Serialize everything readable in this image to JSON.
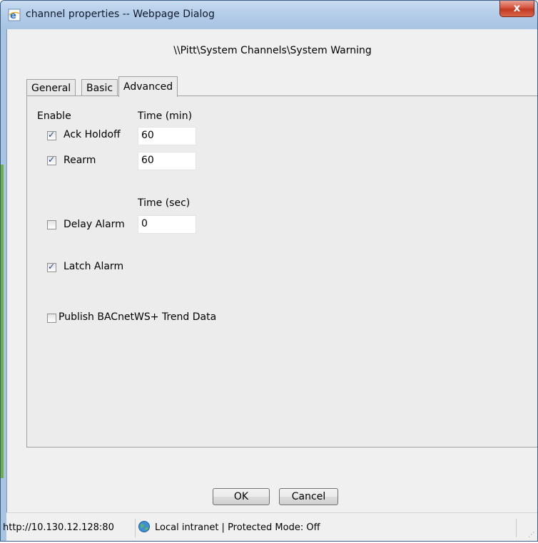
{
  "window": {
    "title": "channel properties -- Webpage Dialog",
    "close_label": "x"
  },
  "header": {
    "channel_path": "\\\\Pitt\\System Channels\\System Warning"
  },
  "tabs": [
    {
      "label": "General",
      "active": false
    },
    {
      "label": "Basic",
      "active": false
    },
    {
      "label": "Advanced",
      "active": true
    }
  ],
  "advanced": {
    "enable_header": "Enable",
    "time_min_header": "Time (min)",
    "time_sec_header": "Time (sec)",
    "ack_holdoff": {
      "label": "Ack Holdoff",
      "checked": true,
      "value": "60"
    },
    "rearm": {
      "label": "Rearm",
      "checked": true,
      "value": "60"
    },
    "delay_alarm": {
      "label": "Delay Alarm",
      "checked": false,
      "value": "0"
    },
    "latch_alarm": {
      "label": "Latch Alarm",
      "checked": true
    },
    "publish_trend": {
      "label": "Publish BACnetWS+ Trend Data",
      "checked": false
    }
  },
  "buttons": {
    "ok": "OK",
    "cancel": "Cancel"
  },
  "statusbar": {
    "url": "http://10.130.12.128:80",
    "zone": "Local intranet | Protected Mode: Off"
  }
}
